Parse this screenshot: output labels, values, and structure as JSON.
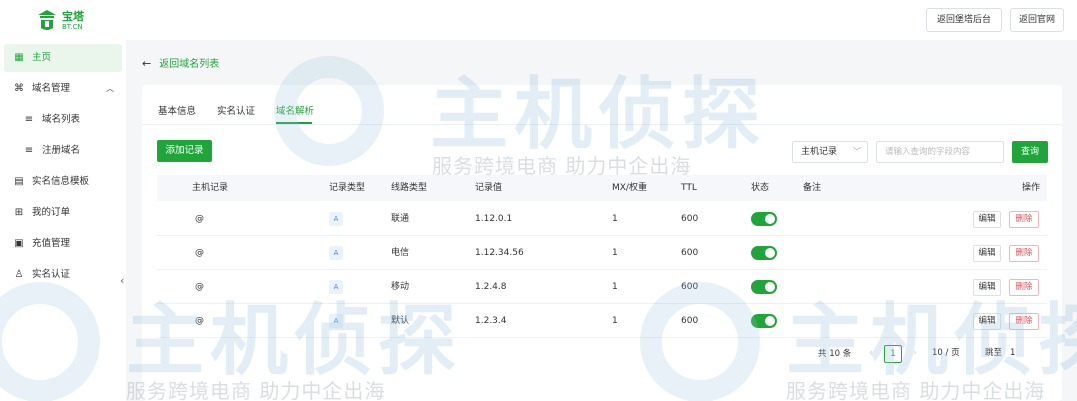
{
  "brand": {
    "name_cn": "宝塔",
    "name_en": "BT.CN",
    "color": "#20a53a"
  },
  "header": {
    "btn_back_panel": "返回堡塔后台",
    "btn_home": "返回官网"
  },
  "sidebar": {
    "items": [
      {
        "label": "主页",
        "icon": "grid-icon",
        "glyph": "▦"
      },
      {
        "label": "域名管理",
        "icon": "command-icon",
        "glyph": "⌘"
      },
      {
        "label": "域名列表",
        "icon": "list-icon",
        "glyph": "≡"
      },
      {
        "label": "注册域名",
        "icon": "register-icon",
        "glyph": "≡"
      },
      {
        "label": "实名信息模板",
        "icon": "id-card-icon",
        "glyph": "▤"
      },
      {
        "label": "我的订单",
        "icon": "cart-icon",
        "glyph": "⊞"
      },
      {
        "label": "充值管理",
        "icon": "wallet-icon",
        "glyph": "▣"
      },
      {
        "label": "实名认证",
        "icon": "user-icon",
        "glyph": "♙"
      }
    ]
  },
  "nav": {
    "back_label": "返回域名列表"
  },
  "tabs": [
    {
      "label": "基本信息"
    },
    {
      "label": "实名认证"
    },
    {
      "label": "域名解析"
    }
  ],
  "toolbar": {
    "add_label": "添加记录",
    "select_value": "主机记录",
    "search_placeholder": "请输入查询的字段内容",
    "query_label": "查询"
  },
  "table": {
    "headers": {
      "host": "主机记录",
      "type": "记录类型",
      "line": "线路类型",
      "value": "记录值",
      "mx": "MX/权重",
      "ttl": "TTL",
      "status": "状态",
      "remark": "备注",
      "ops": "操作"
    },
    "rows": [
      {
        "host": "@",
        "type": "A",
        "line": "联通",
        "value": "1.12.0.1",
        "mx": "1",
        "ttl": "600",
        "status": "on",
        "remark": ""
      },
      {
        "host": "@",
        "type": "A",
        "line": "电信",
        "value": "1.12.34.56",
        "mx": "1",
        "ttl": "600",
        "status": "on",
        "remark": ""
      },
      {
        "host": "@",
        "type": "A",
        "line": "移动",
        "value": "1.2.4.8",
        "mx": "1",
        "ttl": "600",
        "status": "on",
        "remark": ""
      },
      {
        "host": "@",
        "type": "A",
        "line": "默认",
        "value": "1.2.3.4",
        "mx": "1",
        "ttl": "600",
        "status": "on",
        "remark": ""
      }
    ],
    "edit_label": "编辑",
    "delete_label": "删除"
  },
  "pagination": {
    "total": "共 10 条",
    "prev": "‹",
    "current": "1",
    "next": "›",
    "page_size": "10 / 页",
    "goto_label": "跳至",
    "goto_value": "1"
  },
  "watermark": {
    "big": "主机侦探",
    "small": "服务跨境电商 助力中企出海"
  }
}
